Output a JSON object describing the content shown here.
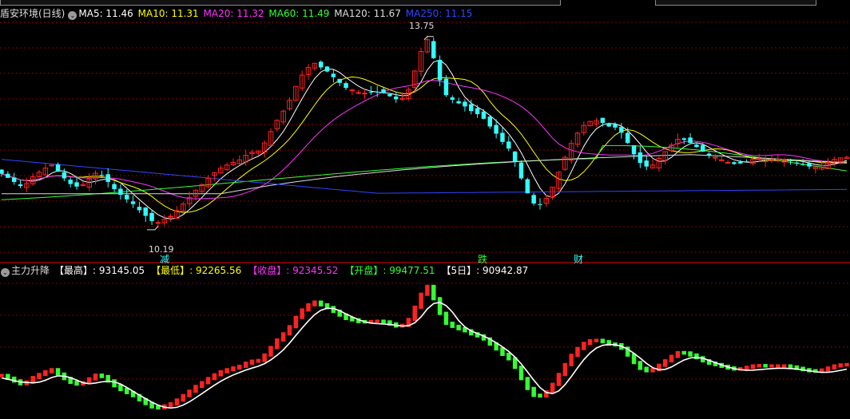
{
  "main_panel": {
    "stock_name": "盾安环境(日线)",
    "indicators": [
      {
        "label": "MA5: 11.46",
        "color": "#ffffff"
      },
      {
        "label": "MA10: 11.31",
        "color": "#ffff00"
      },
      {
        "label": "MA20: 11.32",
        "color": "#ff33ff"
      },
      {
        "label": "MA60: 11.49",
        "color": "#33ff33"
      },
      {
        "label": "MA120: 11.67",
        "color": "#dddddd"
      },
      {
        "label": "MA250: 11.15",
        "color": "#3344ff"
      }
    ],
    "high_marker": "13.75",
    "low_marker": "10.19",
    "annotations": [
      "减",
      "跌",
      "财"
    ]
  },
  "sub_panel": {
    "title": "主力升降",
    "items": [
      {
        "label": "【最高】: 93145.05",
        "color": "#ffffff"
      },
      {
        "label": "【最低】: 92265.56",
        "color": "#ffff00"
      },
      {
        "label": "【收盘】: 92345.52",
        "color": "#ff33ff"
      },
      {
        "label": "【开盘】: 99477.51",
        "color": "#33ff33"
      },
      {
        "label": "【5日】: 90942.87",
        "color": "#ffffff"
      }
    ]
  },
  "colors": {
    "up": "#ff2222",
    "down": "#33ffff",
    "sub_up": "#ff2222",
    "sub_down": "#33ff33",
    "grid": "#8b0000",
    "ma5": "#ffffff",
    "ma10": "#ffff00",
    "ma20": "#ff33ff",
    "ma60": "#33ff33",
    "ma120": "#dddddd",
    "ma250": "#3344ff"
  },
  "chart_data": [
    {
      "type": "candlestick",
      "title": "盾安环境(日线)",
      "price_range": [
        9.55,
        14.15
      ],
      "close": [
        11.14,
        11.06,
        10.98,
        10.9,
        10.95,
        11.08,
        11.17,
        11.25,
        11.31,
        11.18,
        11.05,
        10.94,
        10.89,
        10.93,
        11.04,
        11.15,
        11.11,
        10.98,
        10.84,
        10.73,
        10.64,
        10.55,
        10.43,
        10.32,
        10.22,
        10.19,
        10.25,
        10.31,
        10.42,
        10.55,
        10.68,
        10.82,
        10.93,
        11.05,
        11.16,
        11.25,
        11.31,
        11.36,
        11.41,
        11.5,
        11.56,
        11.58,
        11.74,
        11.96,
        12.18,
        12.36,
        12.57,
        12.84,
        13.06,
        13.21,
        13.29,
        13.21,
        13.13,
        13.02,
        12.91,
        12.81,
        12.77,
        12.72,
        12.71,
        12.72,
        12.73,
        12.71,
        12.65,
        12.59,
        12.61,
        12.78,
        13.14,
        13.52,
        13.75,
        13.39,
        12.96,
        12.67,
        12.58,
        12.51,
        12.45,
        12.36,
        12.3,
        12.21,
        12.06,
        11.92,
        11.76,
        11.63,
        11.38,
        11.05,
        10.76,
        10.56,
        10.54,
        10.66,
        10.88,
        11.17,
        11.46,
        11.73,
        11.93,
        12.08,
        12.16,
        12.17,
        12.13,
        12.06,
        12.04,
        11.94,
        11.74,
        11.52,
        11.35,
        11.28,
        11.31,
        11.44,
        11.57,
        11.7,
        11.81,
        11.8,
        11.74,
        11.66,
        11.57,
        11.5,
        11.46,
        11.41,
        11.36,
        11.33,
        11.34,
        11.38,
        11.42,
        11.43,
        11.42,
        11.42,
        11.42,
        11.42,
        11.39,
        11.35,
        11.31,
        11.28,
        11.27,
        11.3,
        11.36,
        11.42,
        11.45,
        11.46
      ]
    },
    {
      "type": "bar",
      "title": "主力升降",
      "y_range": [
        89000,
        100500
      ]
    }
  ]
}
